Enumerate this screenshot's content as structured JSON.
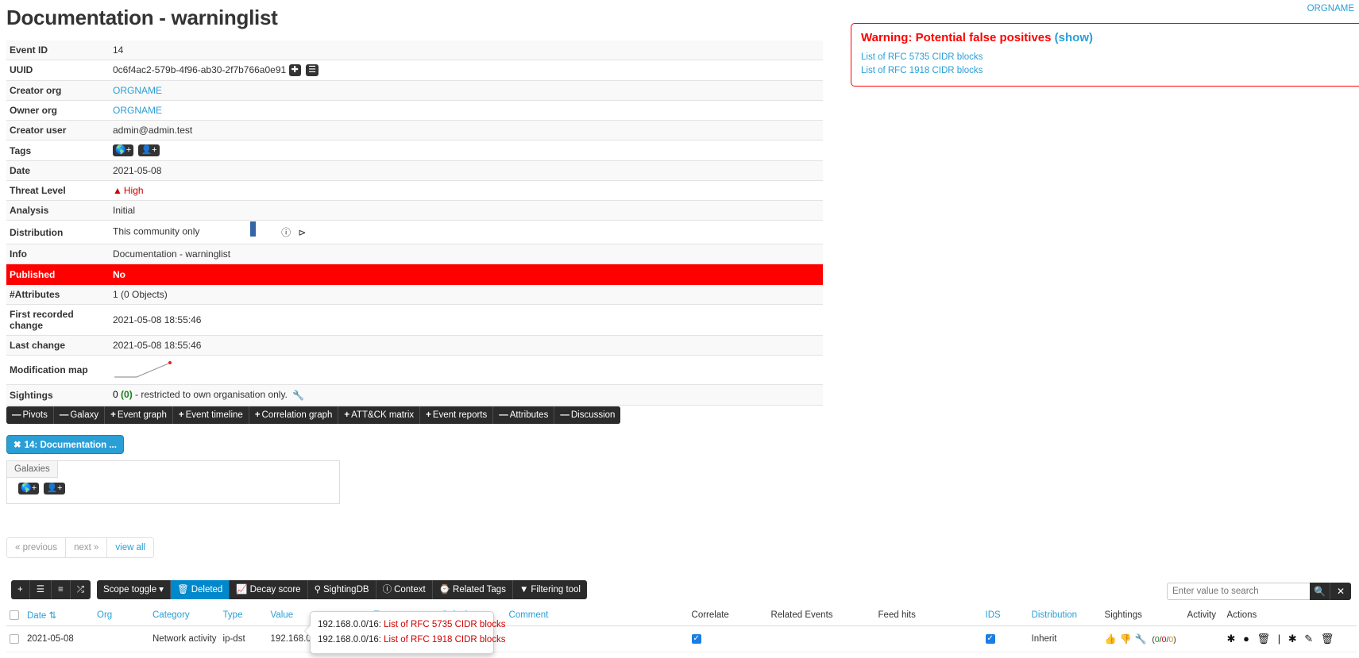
{
  "topbar": {
    "org_link": "ORGNAME"
  },
  "page_title": "Documentation - warninglist",
  "event": {
    "rows": [
      {
        "key": "Event ID",
        "value": "14"
      },
      {
        "key": "UUID",
        "value": "0c6f4ac2-579b-4f96-ab30-2f7b766a0e91"
      },
      {
        "key": "Creator org",
        "value": "ORGNAME"
      },
      {
        "key": "Owner org",
        "value": "ORGNAME"
      },
      {
        "key": "Creator user",
        "value": "admin@admin.test"
      },
      {
        "key": "Tags",
        "value": ""
      },
      {
        "key": "Date",
        "value": "2021-05-08"
      },
      {
        "key": "Threat Level",
        "value": "High"
      },
      {
        "key": "Analysis",
        "value": "Initial"
      },
      {
        "key": "Distribution",
        "value": "This community only"
      },
      {
        "key": "Info",
        "value": "Documentation - warninglist"
      },
      {
        "key": "Published",
        "value": "No"
      },
      {
        "key": "#Attributes",
        "value": "1 (0 Objects)"
      },
      {
        "key": "First recorded change",
        "value": "2021-05-08 18:55:46"
      },
      {
        "key": "Last change",
        "value": "2021-05-08 18:55:46"
      },
      {
        "key": "Modification map",
        "value": ""
      },
      {
        "key": "Sightings",
        "value": ""
      }
    ],
    "sightings": {
      "count": "0",
      "own_count": "(0)",
      "note": "- restricted to own organisation only."
    }
  },
  "nav_pills": [
    {
      "sign": "—",
      "label": "Pivots"
    },
    {
      "sign": "—",
      "label": "Galaxy"
    },
    {
      "sign": "+",
      "label": "Event graph"
    },
    {
      "sign": "+",
      "label": "Event timeline"
    },
    {
      "sign": "+",
      "label": "Correlation graph"
    },
    {
      "sign": "+",
      "label": "ATT&CK matrix"
    },
    {
      "sign": "+",
      "label": "Event reports"
    },
    {
      "sign": "—",
      "label": "Attributes"
    },
    {
      "sign": "—",
      "label": "Discussion"
    }
  ],
  "pivot_chip": {
    "close": "✖",
    "label": "14: Documentation ..."
  },
  "galaxies": {
    "tab_label": "Galaxies"
  },
  "pager": [
    {
      "label": "« previous"
    },
    {
      "label": "next »"
    },
    {
      "label": "view all"
    }
  ],
  "attr_toolbar": {
    "group1": [
      {
        "icon": "plus-icon",
        "label": "+"
      },
      {
        "icon": "list-icon",
        "label": "☰"
      },
      {
        "icon": "indent-icon",
        "label": "≡"
      },
      {
        "icon": "shuffle-icon",
        "label": "⤮"
      }
    ],
    "group2": [
      {
        "icon": "",
        "label": "Scope toggle",
        "caret": "▾",
        "active": false
      },
      {
        "icon": "🗑",
        "label": "Deleted",
        "active": true
      },
      {
        "icon": "↗",
        "label": "Decay score",
        "active": false
      },
      {
        "icon": "♅",
        "label": "SightingDB",
        "active": false
      },
      {
        "icon": "ℹ",
        "label": "Context",
        "active": false
      },
      {
        "icon": "⑂",
        "label": "Related Tags",
        "active": false
      },
      {
        "icon": "▼",
        "label": "Filtering tool",
        "active": false
      }
    ]
  },
  "search": {
    "placeholder": "Enter value to search",
    "value": "",
    "search_icon": "🔍",
    "clear_icon": "✕"
  },
  "attr_table": {
    "headers": [
      {
        "label": "",
        "link": false
      },
      {
        "label": "Date",
        "link": true,
        "sort": "⇅"
      },
      {
        "label": "Org",
        "link": true
      },
      {
        "label": "Category",
        "link": true
      },
      {
        "label": "Type",
        "link": true
      },
      {
        "label": "Value",
        "link": true
      },
      {
        "label": "Tags",
        "link": true
      },
      {
        "label": "Galaxies",
        "link": true
      },
      {
        "label": "Comment",
        "link": true
      },
      {
        "label": "Correlate",
        "link": false
      },
      {
        "label": "Related Events",
        "link": false
      },
      {
        "label": "Feed hits",
        "link": false
      },
      {
        "label": "IDS",
        "link": true
      },
      {
        "label": "Distribution",
        "link": true
      },
      {
        "label": "Sightings",
        "link": false
      },
      {
        "label": "Activity",
        "link": false
      },
      {
        "label": "Actions",
        "link": false
      }
    ],
    "rows": [
      {
        "date": "2021-05-08",
        "org": "",
        "category": "Network activity",
        "type": "ip-dst",
        "value": "192.168.0.1",
        "warn_icon": "⚠",
        "tags": "",
        "galaxies": "",
        "comment": "",
        "correlate": true,
        "related_events": "",
        "feed_hits": "",
        "ids": true,
        "distribution": "Inherit",
        "sightings": "(0/0/0)",
        "sightings_parts": [
          "0",
          "0",
          "0"
        ],
        "activity": "",
        "actions": "✱ ● Ὕ1 | ✱ ✎ Ὕ1"
      }
    ]
  },
  "warning_box": {
    "title": "Warning: Potential false positives",
    "show_label": "(show)",
    "links": [
      "List of RFC 5735 CIDR blocks",
      "List of RFC 1918 CIDR blocks"
    ]
  },
  "popover": {
    "rows": [
      {
        "cidr": "192.168.0.0/16:",
        "list": "List of RFC 5735 CIDR blocks"
      },
      {
        "cidr": "192.168.0.0/16:",
        "list": "List of RFC 1918 CIDR blocks"
      }
    ]
  },
  "colors": {
    "accent": "#2a9fd6",
    "danger": "#ff0000",
    "dark": "#2b2b2b",
    "checkbox": "#1a7ee5"
  }
}
